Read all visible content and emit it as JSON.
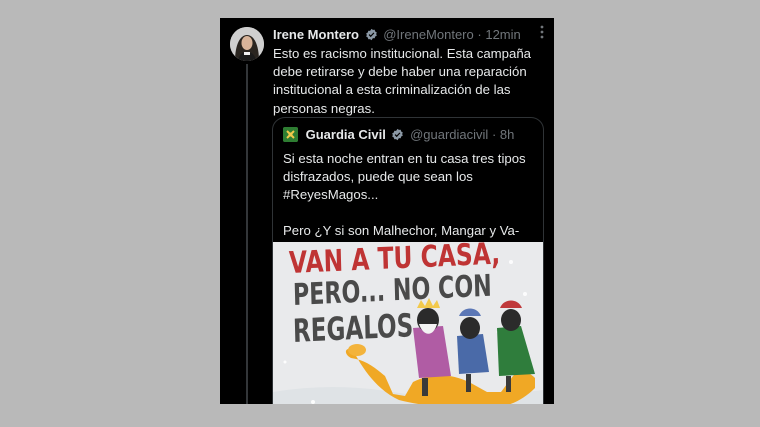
{
  "tweet": {
    "author_name": "Irene Montero",
    "handle": "@IreneMontero",
    "separator": "·",
    "time": "12min",
    "text": "Esto es racismo institucional. Esta campaña debe retirarse y debe haber una reparación institucional a esta criminalización de las personas negras."
  },
  "quote": {
    "author_name": "Guardia Civil",
    "handle": "@guardiacivil",
    "separator": "·",
    "time": "8h",
    "line1": "Si esta noche entran en tu casa tres tipos disfrazados, puede que sean los #ReyesMagos...",
    "line2": "Pero ¿Y si son Malhechor, Mangar y Va-S...",
    "poster": {
      "line1": "VAN A TU CASA,",
      "line2": "PERO... NO CON",
      "line3": "REGALOS"
    }
  },
  "colors": {
    "background": "#000000",
    "text": "#e7e9ea",
    "muted": "#71767b",
    "verified": "#8b98a5",
    "poster_red": "#bf3434"
  },
  "icons": [
    "verified-badge-icon",
    "more-options-icon",
    "guardia-civil-logo-icon"
  ]
}
